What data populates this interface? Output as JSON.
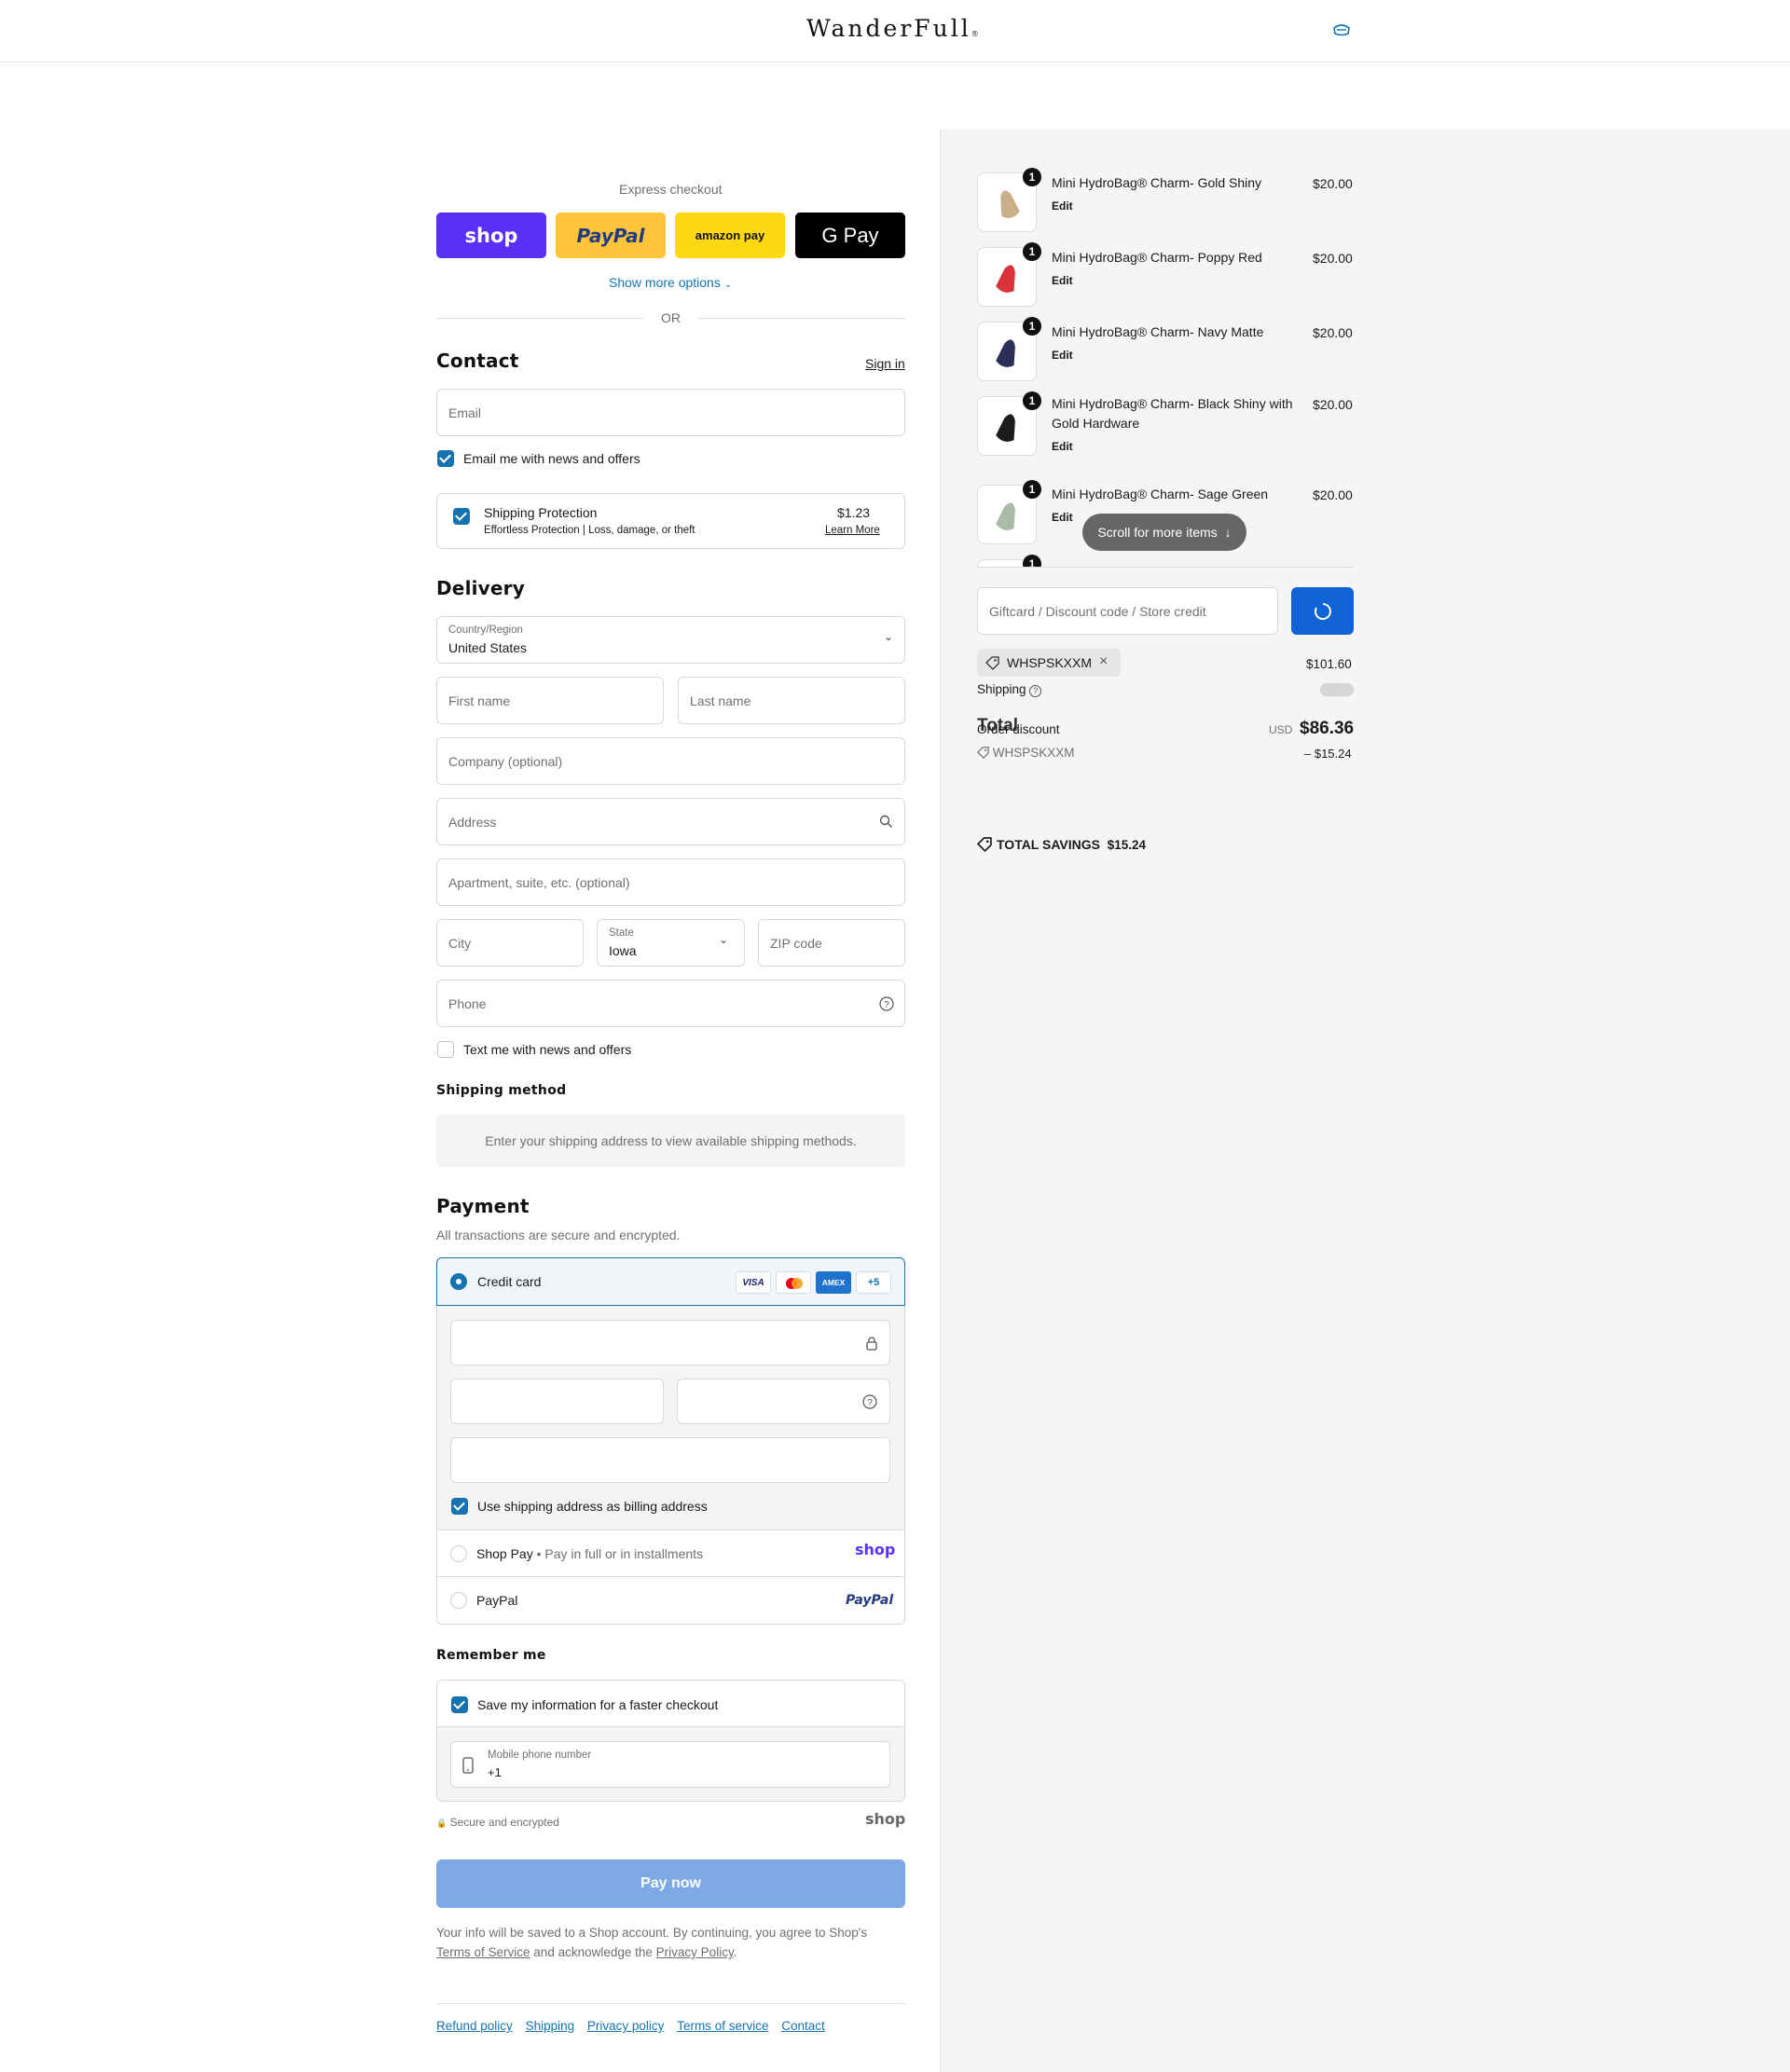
{
  "header": {
    "logo_text": "WanderFull",
    "logo_mark": "®"
  },
  "express": {
    "title": "Express checkout",
    "buttons": [
      {
        "label": "shop",
        "color": "#5a31f4"
      },
      {
        "label": "PayPal",
        "color": "#ffc439"
      },
      {
        "label": "amazon pay",
        "color": "#ffd814"
      },
      {
        "label": "G Pay",
        "color": "#000000"
      }
    ],
    "more_options": "Show more options",
    "or": "OR"
  },
  "contact": {
    "title": "Contact",
    "sign_in": "Sign in",
    "email_placeholder": "Email",
    "email_optin": "Email me with news and offers",
    "protection": {
      "title": "Shipping Protection",
      "subtitle": "Effortless Protection | Loss, damage, or theft",
      "price": "$1.23",
      "learn_more": "Learn More"
    }
  },
  "delivery": {
    "title": "Delivery",
    "country_label": "Country/Region",
    "country_value": "United States",
    "first_name": "First name",
    "last_name": "Last name",
    "company": "Company (optional)",
    "address": "Address",
    "apartment": "Apartment, suite, etc. (optional)",
    "city": "City",
    "state_label": "State",
    "state_value": "Iowa",
    "zip": "ZIP code",
    "phone": "Phone",
    "text_optin": "Text me with news and offers"
  },
  "shipping_method": {
    "title": "Shipping method",
    "message": "Enter your shipping address to view available shipping methods."
  },
  "payment": {
    "title": "Payment",
    "subtitle": "All transactions are secure and encrypted.",
    "credit_card": "Credit card",
    "card_badges": [
      "VISA",
      "",
      "AMEX",
      "+5"
    ],
    "billing_same": "Use shipping address as billing address",
    "shop_pay": "Shop Pay",
    "shop_pay_sub": "Pay in full or in installments",
    "shop_logo": "shop",
    "paypal": "PayPal",
    "paypal_logo": "PayPal"
  },
  "remember": {
    "title": "Remember me",
    "save_info": "Save my information for a faster checkout",
    "mobile_label": "Mobile phone number",
    "mobile_value": "+1",
    "secure": "Secure and encrypted",
    "shop_logo": "shop"
  },
  "pay_now": "Pay now",
  "legal": {
    "line1": "Your info will be saved to a Shop account. By continuing, you agree to Shop's",
    "terms": "Terms of Service",
    "mid": "and acknowledge the",
    "privacy": "Privacy Policy",
    "end": "."
  },
  "footer_links": [
    "Refund policy",
    "Shipping",
    "Privacy policy",
    "Terms of service",
    "Contact"
  ],
  "summary": {
    "items": [
      {
        "name": "Mini HydroBag® Charm- Gold Shiny",
        "price": "$20.00",
        "qty": "1",
        "edit": "Edit",
        "color": "#c9b08a"
      },
      {
        "name": "Mini HydroBag® Charm- Poppy Red",
        "price": "$20.00",
        "qty": "1",
        "edit": "Edit",
        "color": "#d9323a"
      },
      {
        "name": "Mini HydroBag® Charm- Navy Matte",
        "price": "$20.00",
        "qty": "1",
        "edit": "Edit",
        "color": "#2a2f5a"
      },
      {
        "name": "Mini HydroBag® Charm- Black Shiny with",
        "name2": "Gold Hardware",
        "price": "$20.00",
        "qty": "1",
        "edit": "Edit",
        "color": "#1c1c1c"
      },
      {
        "name": "Mini HydroBag® Charm- Sage Green",
        "price": "$20.00",
        "qty": "1",
        "edit": "Edit",
        "color": "#a9bca5"
      }
    ],
    "next_qty": "1",
    "scroll_hint": "Scroll for more items",
    "discount_placeholder": "Giftcard / Discount code / Store credit",
    "applied_code": "WHSPSKXXM",
    "subtotal": "$101.60",
    "shipping_label": "Shipping",
    "order_discount": "Order discount",
    "discount_code": "WHSPSKXXM",
    "discount_amount": "– $15.24",
    "total_label": "Total",
    "currency": "USD",
    "total": "$86.36",
    "savings_label": "TOTAL SAVINGS",
    "savings_amount": "$15.24"
  }
}
